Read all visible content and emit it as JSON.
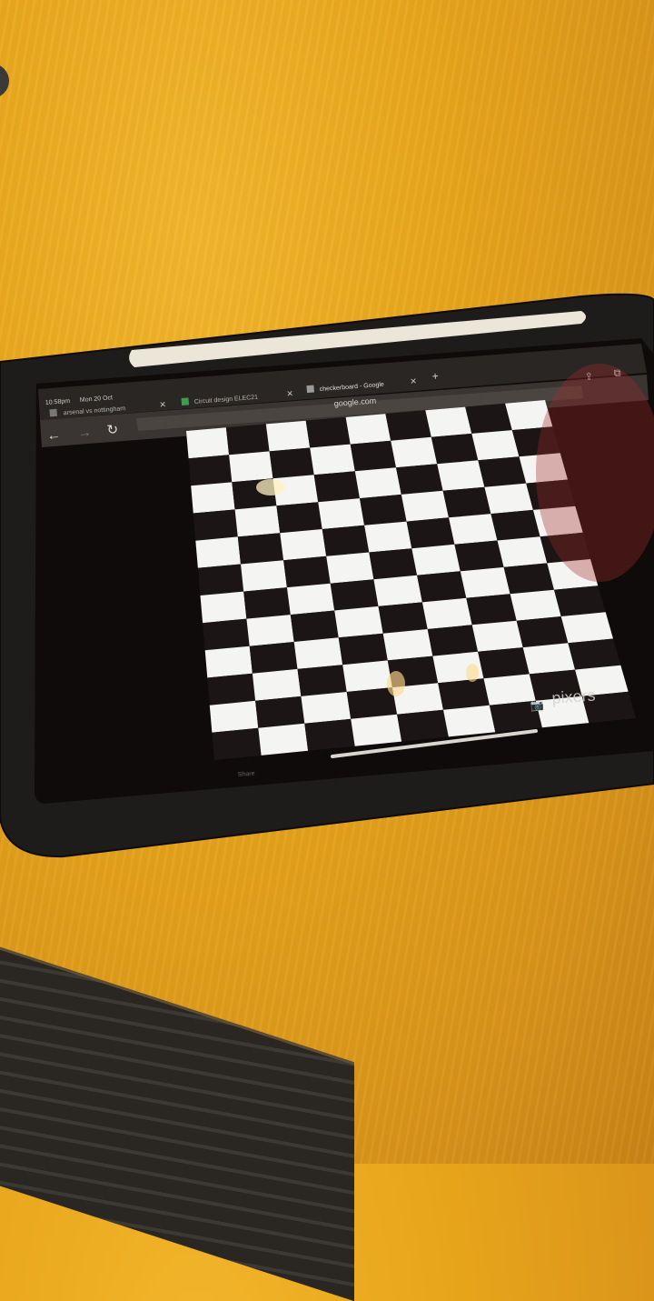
{
  "status_bar": {
    "time": "10:58pm",
    "date": "Mon 20 Oct"
  },
  "browser": {
    "tabs": [
      {
        "label": "arsenal vs nottingham",
        "active": false
      },
      {
        "label": "Circuit design ELEC21",
        "active": false
      },
      {
        "label": "checkerboard - Google",
        "active": true
      }
    ],
    "url": "google.com"
  },
  "image_overlay": {
    "watermark": "pixers",
    "share_label": "Share"
  },
  "board": {
    "columns": 9,
    "rows": 12,
    "light_color": "#f4f4f2",
    "dark_color": "#1b1515"
  },
  "colors": {
    "desk": "#e7a51b",
    "case": "#1e1c1a",
    "pencil": "#ece6d8"
  }
}
